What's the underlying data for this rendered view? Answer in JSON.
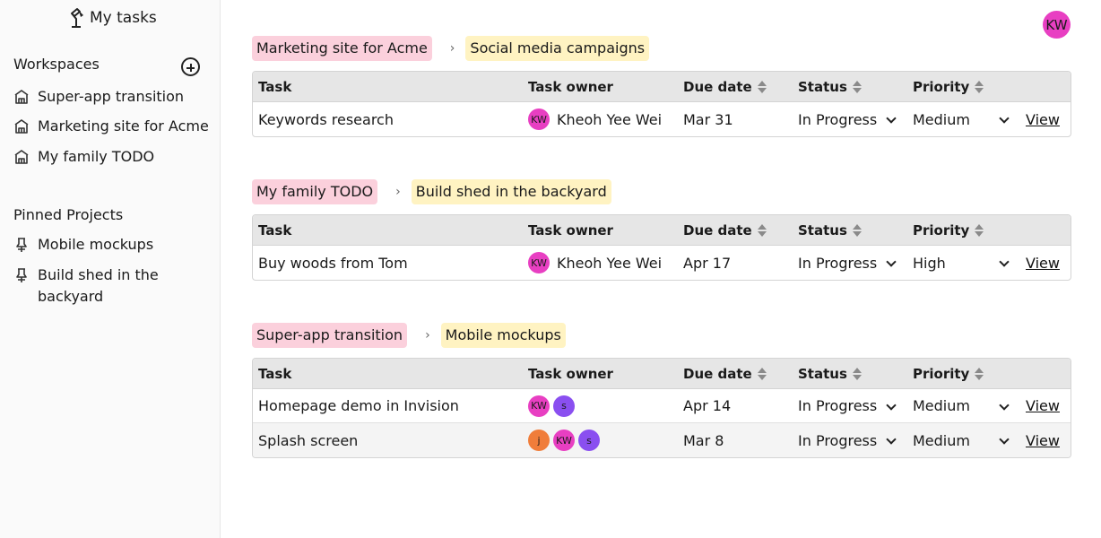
{
  "app": {
    "title": "My tasks"
  },
  "sidebar": {
    "workspaces_heading": "Workspaces",
    "workspaces": [
      {
        "label": "Super-app transition"
      },
      {
        "label": "Marketing site for Acme"
      },
      {
        "label": "My family TODO"
      }
    ],
    "pinned_heading": "Pinned Projects",
    "pinned": [
      {
        "label": "Mobile mockups"
      },
      {
        "label": "Build shed in the backyard"
      }
    ]
  },
  "user": {
    "initials": "KW"
  },
  "columns": {
    "task": "Task",
    "owner": "Task owner",
    "due": "Due date",
    "status": "Status",
    "priority": "Priority"
  },
  "view_label": "View",
  "colors": {
    "pink_chip": "#fbd0dc",
    "yellow_chip": "#fff3c2",
    "avatar_kw": "#e83fc2",
    "avatar_s": "#8a4ff0",
    "avatar_j": "#f07d3a"
  },
  "groups": [
    {
      "workspace": "Marketing site for Acme",
      "project": "Social media campaigns",
      "rows": [
        {
          "task": "Keywords research",
          "owners": [
            "KW"
          ],
          "owner_name": "Kheoh Yee Wei",
          "due": "Mar 31",
          "status": "In Progress",
          "priority": "Medium"
        }
      ]
    },
    {
      "workspace": "My family TODO",
      "project": "Build shed in the backyard",
      "rows": [
        {
          "task": "Buy woods from Tom",
          "owners": [
            "KW"
          ],
          "owner_name": "Kheoh Yee Wei",
          "due": "Apr 17",
          "status": "In Progress",
          "priority": "High"
        }
      ]
    },
    {
      "workspace": "Super-app transition",
      "project": "Mobile mockups",
      "rows": [
        {
          "task": "Homepage demo in Invision",
          "owners": [
            "KW",
            "s"
          ],
          "owner_name": "",
          "due": "Apr 14",
          "status": "In Progress",
          "priority": "Medium"
        },
        {
          "task": "Splash screen",
          "owners": [
            "j",
            "KW",
            "s"
          ],
          "owner_name": "",
          "due": "Mar 8",
          "status": "In Progress",
          "priority": "Medium"
        }
      ]
    }
  ]
}
